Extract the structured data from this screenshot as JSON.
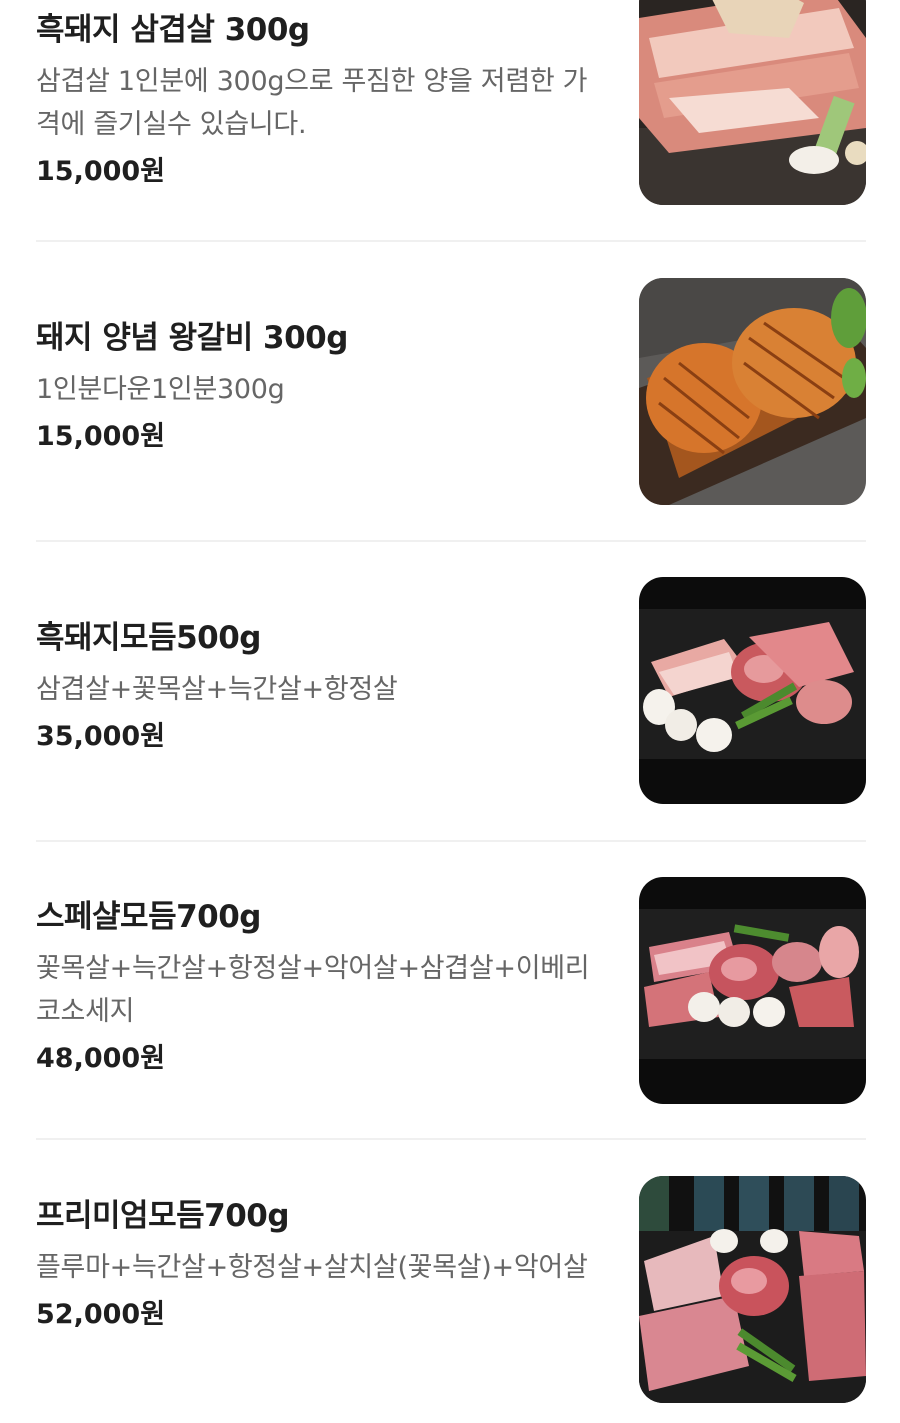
{
  "menu": {
    "items": [
      {
        "name": "흑돼지 삼겹살 300g",
        "description": "삼겹살 1인분에 300g으로 푸짐한 양을 저렴한 가격에 즐기실수 있습니다.",
        "price": "15,000원",
        "image_icon": "pork-belly-grill-photo"
      },
      {
        "name": "돼지 양념 왕갈비 300g",
        "description": "1인분다운1인분300g",
        "price": "15,000원",
        "image_icon": "marinated-rib-photo"
      },
      {
        "name": "흑돼지모듬500g",
        "description": "삼겹살+꽃목살+늑간살+항정살",
        "price": "35,000원",
        "image_icon": "assorted-pork-platter-photo"
      },
      {
        "name": "스페샬모듬700g",
        "description": "꽃목살+늑간살+항정살+악어살+삼겹살+이베리코소세지",
        "price": "48,000원",
        "image_icon": "special-assorted-platter-photo"
      },
      {
        "name": "프리미엄모듬700g",
        "description": "플루마+늑간살+항정살+살치살(꽃목살)+악어살",
        "price": "52,000원",
        "image_icon": "premium-assorted-platter-photo"
      }
    ]
  },
  "colors": {
    "text_primary": "#1f1f1f",
    "text_secondary": "#666666",
    "divider": "#f0f0f0",
    "background": "#ffffff"
  }
}
